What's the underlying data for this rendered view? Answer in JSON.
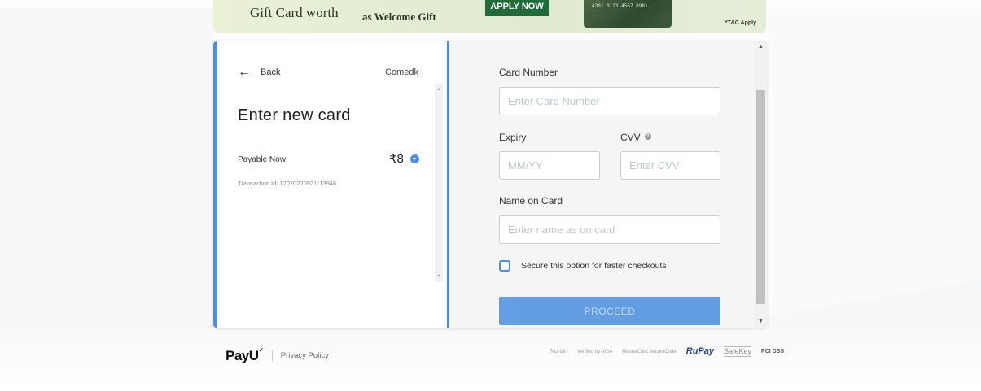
{
  "banner": {
    "gift_text": "Gift Card worth",
    "welcome_text": "as Welcome Gift",
    "apply_label": "APPLY NOW",
    "card_number": "4301 0123 4567 8901",
    "tnc": "*T&C Apply"
  },
  "left": {
    "back_label": "Back",
    "merchant": "Comedk",
    "title": "Enter new card",
    "payable_label": "Payable Now",
    "amount": "₹8",
    "transaction": "Transaction Id: 17020220921113946"
  },
  "form": {
    "card_number_label": "Card Number",
    "card_number_placeholder": "Enter Card Number",
    "expiry_label": "Expiry",
    "expiry_placeholder": "MM/YY",
    "cvv_label": "CVV",
    "cvv_placeholder": "Enter CVV",
    "name_label": "Name on Card",
    "name_placeholder": "Enter name as on card",
    "secure_label": "Secure this option for faster checkouts",
    "proceed_label": "PROCEED"
  },
  "footer": {
    "logo": "PayU",
    "privacy": "Privacy Policy",
    "badges": [
      "Norton",
      "Verified by VISA",
      "MasterCard SecureCode",
      "RuPay",
      "SafeKey",
      "PCI DSS"
    ]
  },
  "colors": {
    "accent": "#4a8fe0",
    "proceed_bg": "#4a8fe0",
    "banner_green": "#1f6b3a"
  }
}
